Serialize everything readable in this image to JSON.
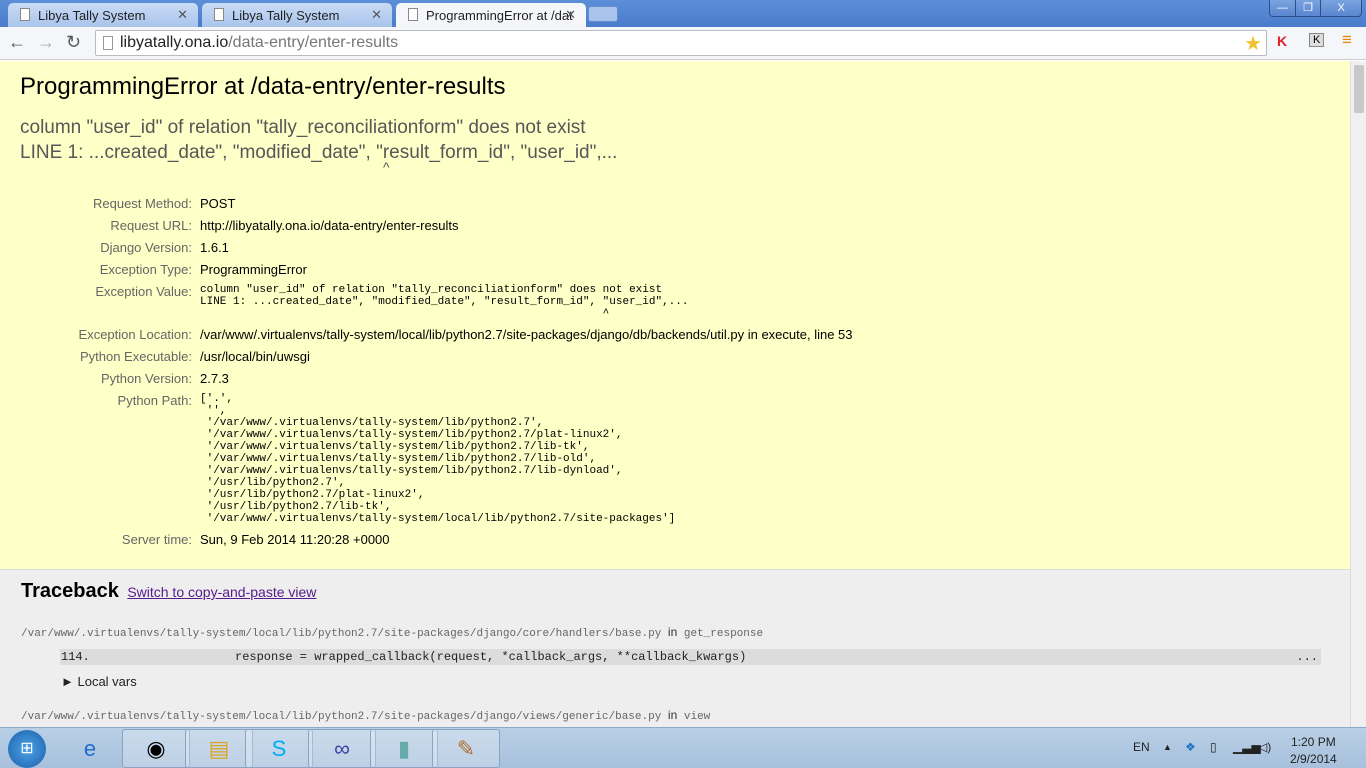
{
  "browser": {
    "tabs": [
      {
        "label": "Libya Tally System"
      },
      {
        "label": "Libya Tally System"
      },
      {
        "label": "ProgrammingError at /dat"
      }
    ],
    "url_host": "libyatally.ona.io",
    "url_path": "/data-entry/enter-results",
    "window_controls": {
      "minimize": "—",
      "restore": "❐",
      "close": "X"
    }
  },
  "summary": {
    "title": "ProgrammingError at /data-entry/enter-results",
    "exception_line1": "column \"user_id\" of relation \"tally_reconciliationform\" does not exist",
    "exception_line2": "LINE 1: ...created_date\", \"modified_date\", \"result_form_id\", \"user_id\",...",
    "caret": "^",
    "meta": [
      {
        "label": "Request Method:",
        "value": "POST"
      },
      {
        "label": "Request URL:",
        "value": "http://libyatally.ona.io/data-entry/enter-results"
      },
      {
        "label": "Django Version:",
        "value": "1.6.1"
      },
      {
        "label": "Exception Type:",
        "value": "ProgrammingError"
      },
      {
        "label": "Exception Value:",
        "value": "column \"user_id\" of relation \"tally_reconciliationform\" does not exist\nLINE 1: ...created_date\", \"modified_date\", \"result_form_id\", \"user_id\",...\n                                                             ^"
      },
      {
        "label": "Exception Location:",
        "value": "/var/www/.virtualenvs/tally-system/local/lib/python2.7/site-packages/django/db/backends/util.py in execute, line 53"
      },
      {
        "label": "Python Executable:",
        "value": "/usr/local/bin/uwsgi"
      },
      {
        "label": "Python Version:",
        "value": "2.7.3"
      },
      {
        "label": "Python Path:",
        "value": "['.',\n '',\n '/var/www/.virtualenvs/tally-system/lib/python2.7',\n '/var/www/.virtualenvs/tally-system/lib/python2.7/plat-linux2',\n '/var/www/.virtualenvs/tally-system/lib/python2.7/lib-tk',\n '/var/www/.virtualenvs/tally-system/lib/python2.7/lib-old',\n '/var/www/.virtualenvs/tally-system/lib/python2.7/lib-dynload',\n '/usr/lib/python2.7',\n '/usr/lib/python2.7/plat-linux2',\n '/usr/lib/python2.7/lib-tk',\n '/var/www/.virtualenvs/tally-system/local/lib/python2.7/site-packages']"
      },
      {
        "label": "Server time:",
        "value": "Sun, 9 Feb 2014 11:20:28 +0000"
      }
    ]
  },
  "traceback": {
    "title": "Traceback",
    "switch_link": "Switch to copy-and-paste view",
    "frames": [
      {
        "file": "/var/www/.virtualenvs/tally-system/local/lib/python2.7/site-packages/django/core/handlers/base.py",
        "in": "in",
        "func": "get_response",
        "lineno": "114.",
        "code": "response = wrapped_callback(request, *callback_args, **callback_kwargs)",
        "dots": "...",
        "locals": "► Local vars"
      },
      {
        "file": "/var/www/.virtualenvs/tally-system/local/lib/python2.7/site-packages/django/views/generic/base.py",
        "in": "in",
        "func": "view"
      }
    ]
  },
  "taskbar": {
    "lang": "EN",
    "time": "1:20 PM",
    "date": "2/9/2014"
  },
  "colors": {
    "summary_bg": "#ffffc8",
    "traceback_bg": "#eeeeee",
    "link": "#551a8b"
  }
}
